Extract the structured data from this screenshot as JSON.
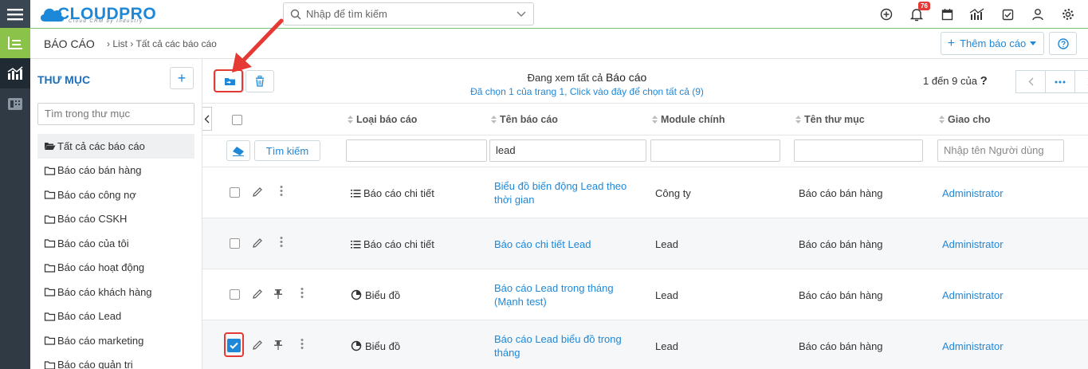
{
  "app": {
    "logo_text": "CLOUDPRO",
    "logo_sub": "Cloud CRM by Industry",
    "search_placeholder": "Nhập để tìm kiếm",
    "notification_count": "76"
  },
  "breadcrumb": {
    "title": "BÁO CÁO",
    "path": "› List › Tất cả các báo cáo",
    "add_report_label": "Thêm báo cáo"
  },
  "folders": {
    "heading": "THƯ MỤC",
    "search_placeholder": "Tìm trong thư mục",
    "items": [
      {
        "label": "Tất cả các báo cáo",
        "selected": true
      },
      {
        "label": "Báo cáo bán hàng"
      },
      {
        "label": "Báo cáo công nợ"
      },
      {
        "label": "Báo cáo CSKH"
      },
      {
        "label": "Báo cáo của tôi"
      },
      {
        "label": "Báo cáo hoạt động"
      },
      {
        "label": "Báo cáo khách hàng"
      },
      {
        "label": "Báo cáo Lead"
      },
      {
        "label": "Báo cáo marketing"
      },
      {
        "label": "Báo cáo quản trị"
      }
    ]
  },
  "list": {
    "viewing_prefix": "Đang xem tất cả ",
    "viewing_entity": "Báo cáo",
    "selection_info": "Đã chọn 1 của trang 1, Click vào đây để chọn tất cả (9)",
    "pager_text": "1 đến 9 của",
    "pager_q": "?",
    "columns": [
      "Loại báo cáo",
      "Tên báo cáo",
      "Module chính",
      "Tên thư mục",
      "Giao cho"
    ],
    "filters": {
      "search_button": "Tìm kiếm",
      "name_value": "lead",
      "assignee_placeholder": "Nhập tên Người dùng"
    },
    "rows": [
      {
        "type": "Báo cáo chi tiết",
        "type_icon": "list-icon",
        "name": "Biểu đồ biến động Lead theo thời gian",
        "module": "Công ty",
        "folder": "Báo cáo bán hàng",
        "assignee": "Administrator",
        "checked": false,
        "pinned": false
      },
      {
        "type": "Báo cáo chi tiết",
        "type_icon": "list-icon",
        "name": "Báo cáo chi tiết Lead",
        "module": "Lead",
        "folder": "Báo cáo bán hàng",
        "assignee": "Administrator",
        "checked": false,
        "pinned": false
      },
      {
        "type": "Biểu đồ",
        "type_icon": "pie-chart-icon",
        "name": "Báo cáo Lead trong tháng (Mạnh test)",
        "module": "Lead",
        "folder": "Báo cáo bán hàng",
        "assignee": "Administrator",
        "checked": false,
        "pinned": true
      },
      {
        "type": "Biểu đồ",
        "type_icon": "pie-chart-icon",
        "name": "Báo cáo Lead biểu đồ trong tháng",
        "module": "Lead",
        "folder": "Báo cáo bán hàng",
        "assignee": "Administrator",
        "checked": true,
        "pinned": true
      }
    ]
  },
  "colors": {
    "accent": "#1e88d8",
    "highlight": "#e53935",
    "rail": "#2f3a45",
    "rail_active": "#8bc34a"
  }
}
